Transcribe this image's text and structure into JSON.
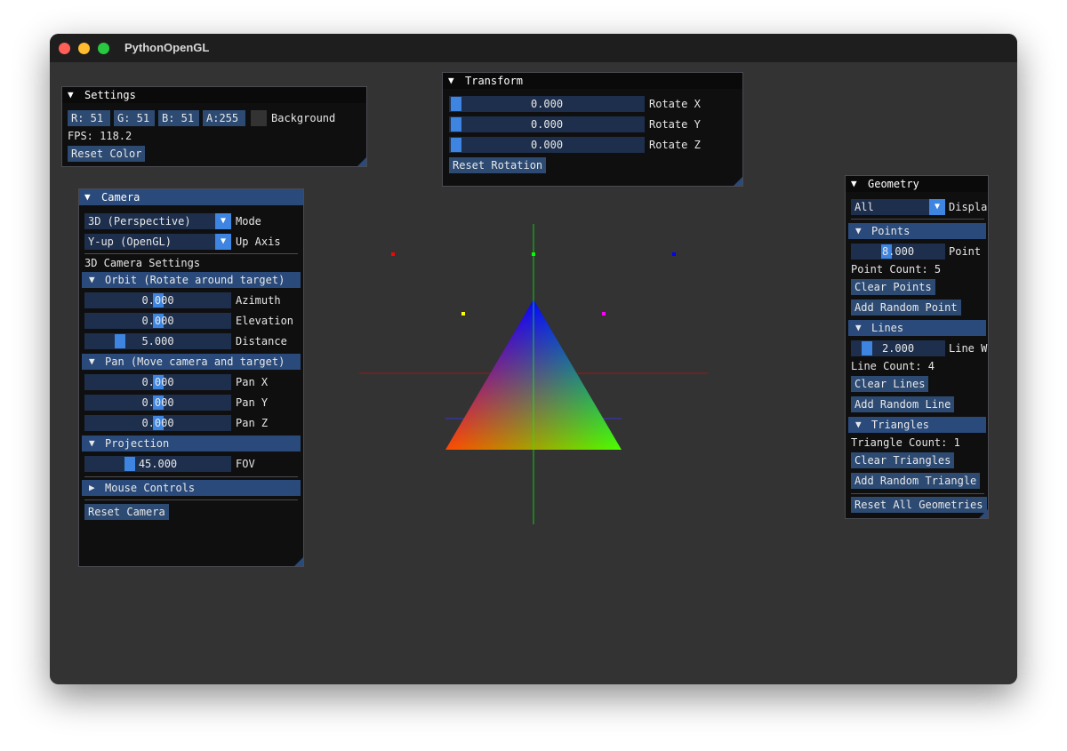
{
  "window": {
    "title": "PythonOpenGL",
    "background": "#333333"
  },
  "settings": {
    "title": "Settings",
    "r": "R: 51",
    "g": "G: 51",
    "b": "B: 51",
    "a": "A:255",
    "background_label": "Background",
    "fps": "FPS: 118.2",
    "reset_color": "Reset Color"
  },
  "transform": {
    "title": "Transform",
    "rows": [
      {
        "value": "0.000",
        "label": "Rotate X"
      },
      {
        "value": "0.000",
        "label": "Rotate Y"
      },
      {
        "value": "0.000",
        "label": "Rotate Z"
      }
    ],
    "reset": "Reset Rotation"
  },
  "camera": {
    "title": "Camera",
    "mode_value": "3D (Perspective)",
    "mode_label": "Mode",
    "up_value": "Y-up (OpenGL)",
    "up_label": "Up Axis",
    "settings_label": "3D Camera Settings",
    "orbit_header": "Orbit (Rotate around target)",
    "azimuth": {
      "value": "0.000",
      "label": "Azimuth"
    },
    "elevation": {
      "value": "0.000",
      "label": "Elevation"
    },
    "distance": {
      "value": "5.000",
      "label": "Distance"
    },
    "pan_header": "Pan (Move camera and target)",
    "pan_x": {
      "value": "0.000",
      "label": "Pan X"
    },
    "pan_y": {
      "value": "0.000",
      "label": "Pan Y"
    },
    "pan_z": {
      "value": "0.000",
      "label": "Pan Z"
    },
    "projection_header": "Projection",
    "fov": {
      "value": "45.000",
      "label": "FOV"
    },
    "mouse_header": "Mouse Controls",
    "reset": "Reset Camera"
  },
  "geometry": {
    "title": "Geometry",
    "display_value": "All",
    "display_label": "Display",
    "points_header": "Points",
    "point_size": {
      "value": "8.000",
      "label": "Point Size"
    },
    "point_count": "Point Count: 5",
    "clear_points": "Clear Points",
    "add_point": "Add Random Point",
    "lines_header": "Lines",
    "line_width": {
      "value": "2.000",
      "label": "Line Width"
    },
    "line_count": "Line Count: 4",
    "clear_lines": "Clear Lines",
    "add_line": "Add Random Line",
    "triangles_header": "Triangles",
    "triangle_count": "Triangle Count: 1",
    "clear_triangles": "Clear Triangles",
    "add_triangle": "Add Random Triangle",
    "reset_all": "Reset All Geometries"
  },
  "scene": {
    "colors": {
      "red": "#ff0000",
      "green": "#00ff00",
      "blue": "#0000ff",
      "yellow": "#ffff00",
      "magenta": "#ff00ff"
    }
  }
}
